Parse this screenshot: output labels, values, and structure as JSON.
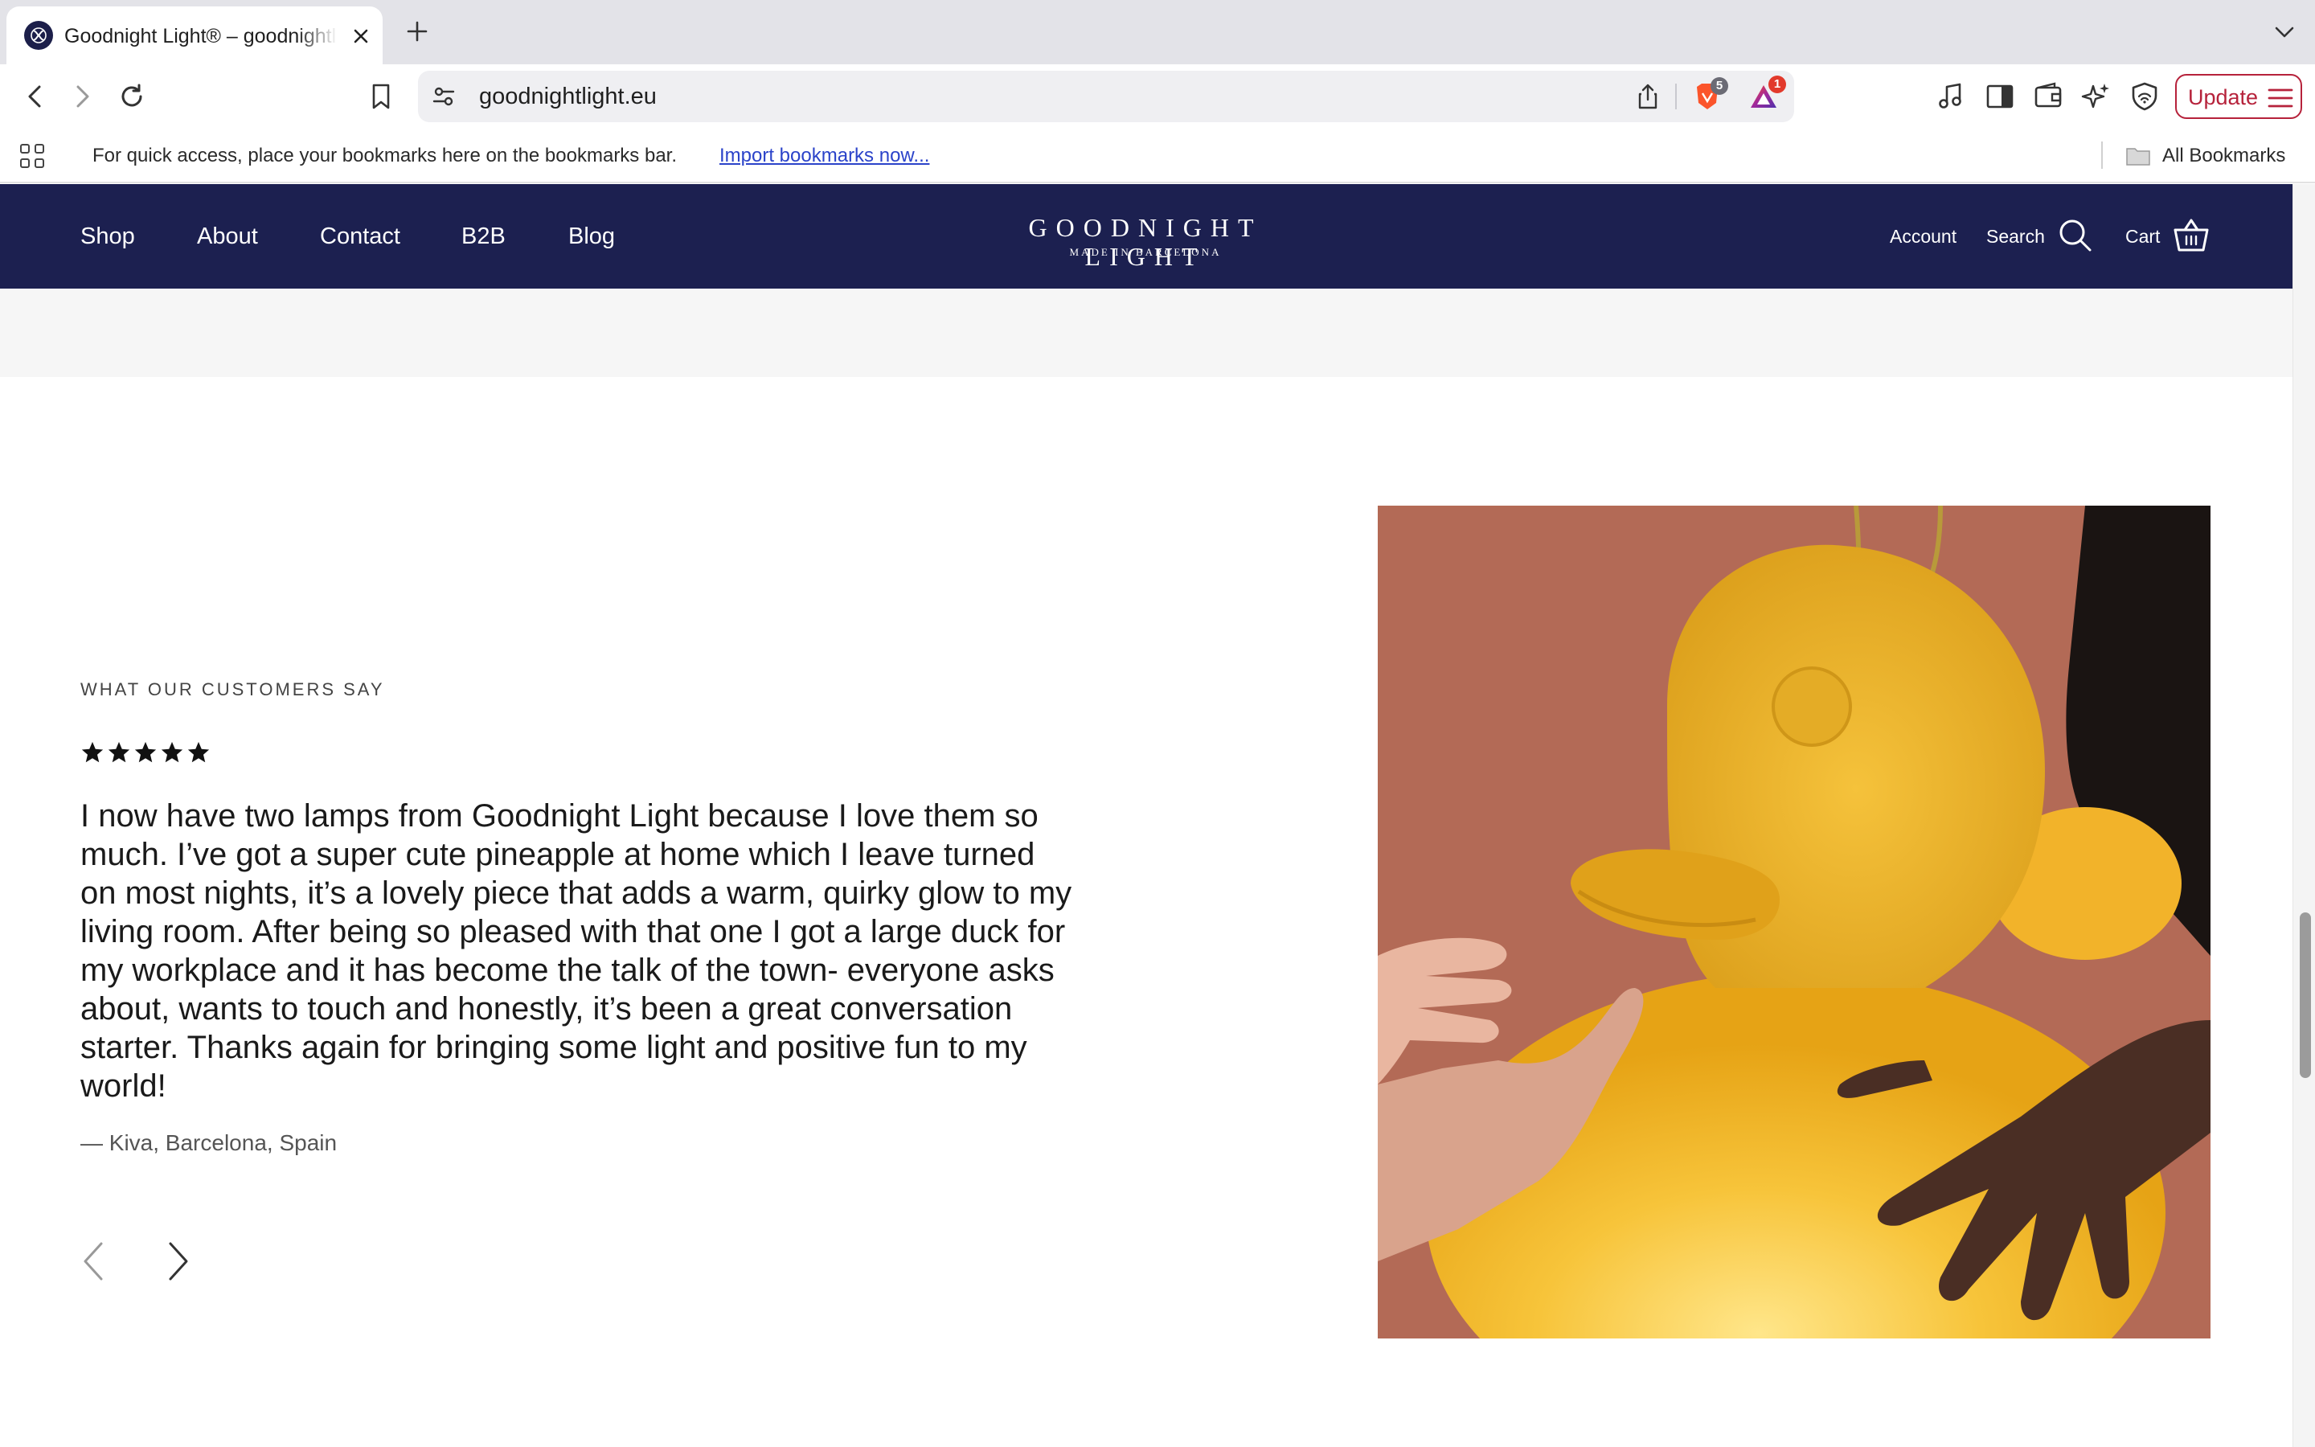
{
  "browser": {
    "tab_title": "Goodnight Light® – goodnightlight.eu",
    "url": "goodnightlight.eu",
    "shields_count": "5",
    "rewards_count": "1",
    "update_label": "Update",
    "bookmarks_hint": "For quick access, place your bookmarks here on the bookmarks bar.",
    "import_link": "Import bookmarks now...",
    "all_bookmarks": "All Bookmarks"
  },
  "nav": {
    "links": [
      "Shop",
      "About",
      "Contact",
      "B2B",
      "Blog"
    ],
    "logo_main": "GOODNIGHT LIGHT",
    "logo_sub": "MADE IN BARCELONA",
    "account": "Account",
    "search": "Search",
    "cart": "Cart",
    "background_color": "#1c2050"
  },
  "testimonial": {
    "eyebrow": "WHAT OUR CUSTOMERS SAY",
    "rating": 5,
    "rating_max": 5,
    "quote": "I now have two lamps from Goodnight Light because I love them so much. I’ve got a super cute pineapple at home which I leave turned on most nights, it’s a lovely piece that adds a warm, quirky glow to my living room. After being so pleased with that one I got a large duck for my workplace and it has become the talk of the town- everyone asks about, wants to touch and honestly, it’s been a great conversation starter. Thanks again for bringing some light and positive fun to my world!",
    "author": "— Kiva, Barcelona, Spain"
  },
  "icons": {
    "prev": "chevron-left-icon",
    "next": "chevron-right-icon",
    "search": "search-icon",
    "cart": "basket-icon"
  }
}
